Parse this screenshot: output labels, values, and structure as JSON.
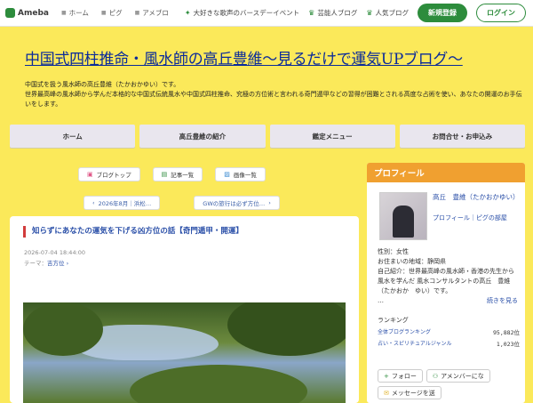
{
  "topbar": {
    "logo": "Ameba",
    "nav": [
      {
        "label": "ホーム",
        "icon": "home-icon"
      },
      {
        "label": "ピグ",
        "icon": "pig-icon"
      },
      {
        "label": "アメブロ",
        "icon": "blog-icon"
      }
    ],
    "right_links": [
      {
        "label": "大好きな歌声のバースデーイベント",
        "icon": "cake-icon"
      },
      {
        "label": "芸能人ブログ",
        "icon": "crown-icon"
      },
      {
        "label": "人気ブログ",
        "icon": "crown-icon"
      }
    ],
    "register": "新規登録",
    "login": "ログイン"
  },
  "header": {
    "title": "中国式四柱推命・風水師の高丘豊維〜見るだけで運気UPブログ〜",
    "desc_line1": "中国式を扱う風水師の高丘豊維（たかおかゆい）です。",
    "desc_line2": "世界最高峰の風水師から学んだ本格的な中国式伝統風水や中国式四柱推命、究極の方位術と言われる奇門遁甲などの習得が困難とされる高度な占術を使い、あなたの開運のお手伝いをします。"
  },
  "menu": [
    "ホーム",
    "高丘豊維の紹介",
    "鑑定メニュー",
    "お問合せ・お申込み"
  ],
  "bloglinks": [
    {
      "label": "ブログトップ",
      "icon": "blog-top-icon"
    },
    {
      "label": "記事一覧",
      "icon": "list-icon"
    },
    {
      "label": "画像一覧",
      "icon": "image-icon"
    }
  ],
  "pager": {
    "prev": "2026年8月｜浜松…",
    "next": "GWの旅行は必ず方位…"
  },
  "article": {
    "title": "知らずにあなたの運気を下げる凶方位の話【奇門遁甲・開運】",
    "date": "2026-07-04 18:44:00",
    "theme_label": "テーマ：",
    "theme": "吉方位"
  },
  "sidebar": {
    "heading": "プロフィール",
    "name": "高丘　豊維（たかおかゆい）",
    "links": "プロフィール｜ピグの部屋",
    "gender": "性別：女性",
    "location": "お住まいの地域：静岡県",
    "intro": "自己紹介：世界最高峰の風水師・香港の先生から風水を学んだ 風水コンサルタントの高丘　豊維（たかおか　ゆい）です。",
    "intro_more": "…",
    "more": "続きを見る",
    "ranking_title": "ランキング",
    "rankings": [
      {
        "label": "全体ブログランキング",
        "value": "95,882位"
      },
      {
        "label": "占い・スピリチュアルジャンル",
        "value": "1,023位"
      }
    ],
    "follow": "フォロー",
    "amember": "アメンバーにな",
    "message": "メッセージを送"
  },
  "colors": {
    "bg": "#fbe95a",
    "accent": "#2d8c3c",
    "title": "#0a2a9a",
    "profile": "#f0a030"
  }
}
